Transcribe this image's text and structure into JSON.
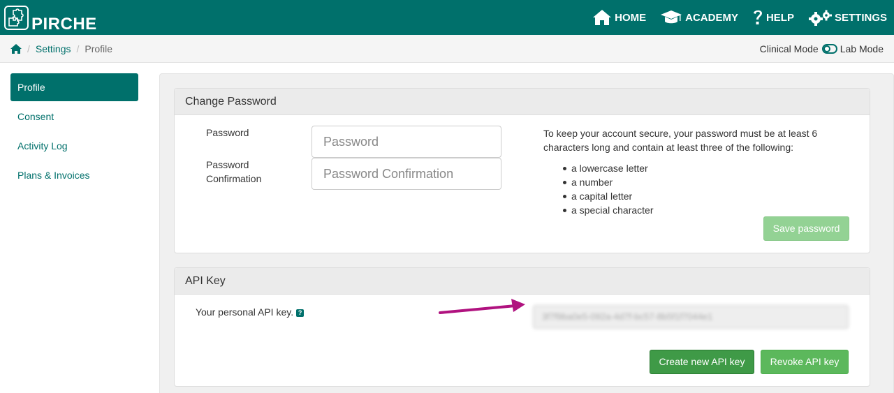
{
  "brand": {
    "name": "PIRCHE"
  },
  "nav": [
    {
      "label": "HOME",
      "icon": "home-icon"
    },
    {
      "label": "ACADEMY",
      "icon": "graduation-cap-icon"
    },
    {
      "label": "HELP",
      "icon": "question-icon"
    },
    {
      "label": "SETTINGS",
      "icon": "gears-icon"
    }
  ],
  "breadcrumb": {
    "home_icon": "home-icon",
    "settings": "Settings",
    "current": "Profile"
  },
  "mode": {
    "left": "Clinical Mode",
    "right": "Lab Mode"
  },
  "sidebar": {
    "items": [
      {
        "label": "Profile",
        "active": true
      },
      {
        "label": "Consent"
      },
      {
        "label": "Activity Log"
      },
      {
        "label": "Plans & Invoices"
      }
    ]
  },
  "password_panel": {
    "title": "Change Password",
    "password_label": "Password",
    "password_placeholder": "Password",
    "confirm_label_1": "Password",
    "confirm_label_2": "Confirmation",
    "confirm_placeholder": "Password Confirmation",
    "help_text": "To keep your account secure, your password must be at least 6 characters long and contain at least three of the following:",
    "rules": [
      "a lowercase letter",
      "a number",
      "a capital letter",
      "a special character"
    ],
    "save_label": "Save password"
  },
  "api_panel": {
    "title": "API Key",
    "label": "Your personal API key.",
    "help_icon": "?",
    "key_value": "3f7f9ba0e5-092a-4d7f-bc57-8b5f1f7044e1",
    "create_label": "Create new API key",
    "revoke_label": "Revoke API key"
  },
  "colors": {
    "brand": "#00706b",
    "arrow": "#b0127f",
    "button_green": "#5cb85c"
  }
}
